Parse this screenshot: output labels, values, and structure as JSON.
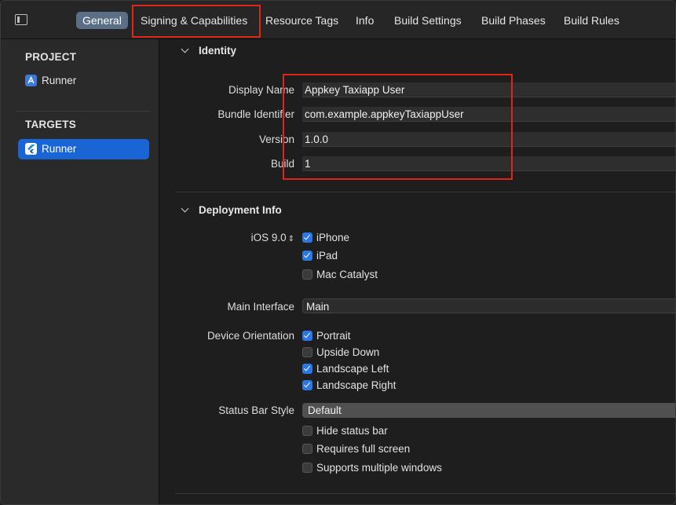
{
  "tabs": {
    "general": "General",
    "signing": "Signing & Capabilities",
    "resource_tags": "Resource Tags",
    "info": "Info",
    "build_settings": "Build Settings",
    "build_phases": "Build Phases",
    "build_rules": "Build Rules"
  },
  "sidebar": {
    "project_header": "PROJECT",
    "project_item": "Runner",
    "targets_header": "TARGETS",
    "target_item": "Runner"
  },
  "identity": {
    "title": "Identity",
    "display_name_label": "Display Name",
    "display_name": "Appkey Taxiapp User",
    "bundle_id_label": "Bundle Identifier",
    "bundle_id": "com.example.appkeyTaxiappUser",
    "version_label": "Version",
    "version": "1.0.0",
    "build_label": "Build",
    "build": "1"
  },
  "deployment": {
    "title": "Deployment Info",
    "ios_version": "iOS 9.0",
    "iphone": "iPhone",
    "ipad": "iPad",
    "mac_catalyst": "Mac Catalyst",
    "main_interface_label": "Main Interface",
    "main_interface": "Main",
    "orientation_label": "Device Orientation",
    "portrait": "Portrait",
    "upside_down": "Upside Down",
    "landscape_left": "Landscape Left",
    "landscape_right": "Landscape Right",
    "status_bar_label": "Status Bar Style",
    "status_bar_style": "Default",
    "hide_status_bar": "Hide status bar",
    "requires_full_screen": "Requires full screen",
    "multiple_windows": "Supports multiple windows"
  },
  "colors": {
    "accent": "#1a65d6",
    "highlight_box": "#e0261b",
    "active_tab": "#5a6e85"
  }
}
